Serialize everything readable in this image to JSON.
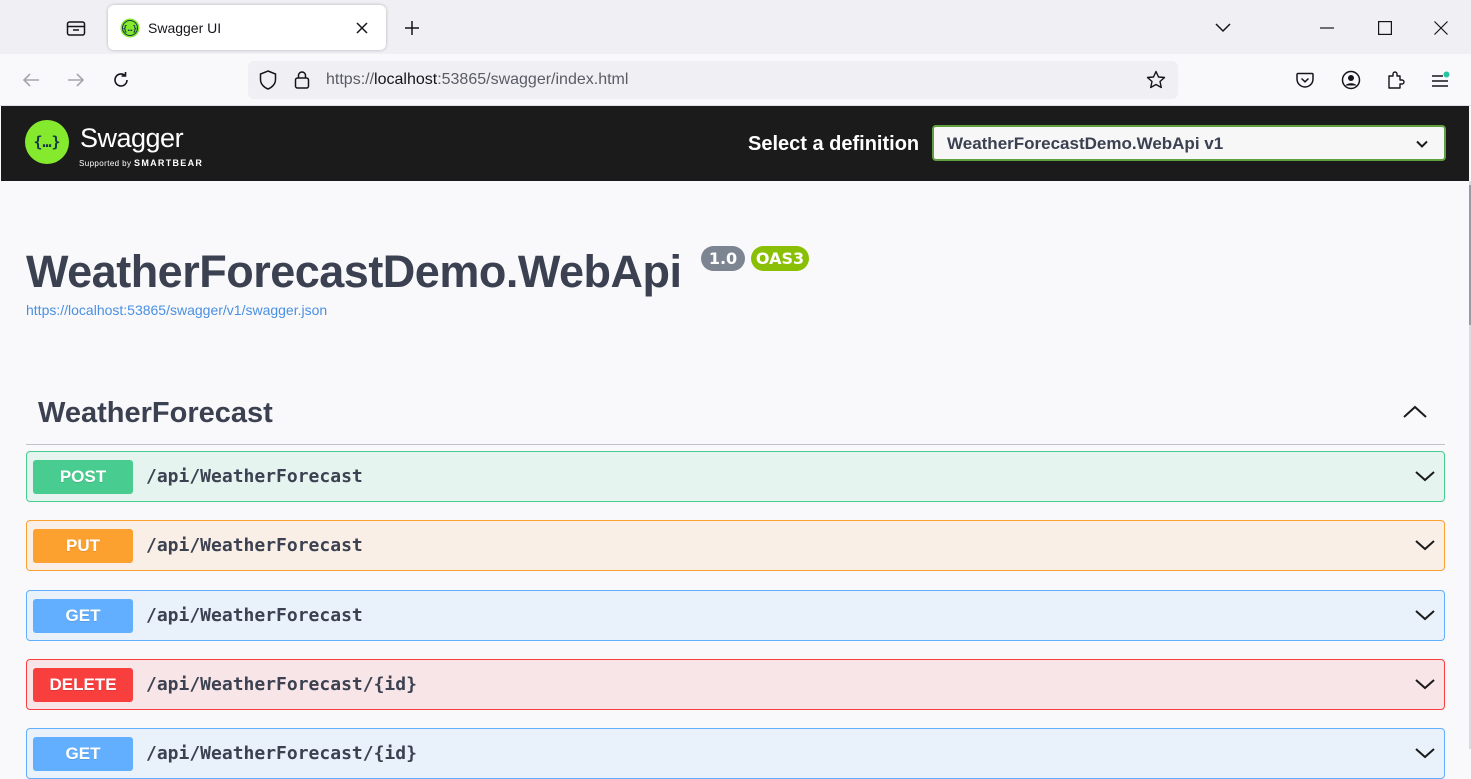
{
  "browser": {
    "tab": {
      "title": "Swagger UI"
    },
    "url": {
      "scheme": "https://",
      "host": "localhost",
      "rest": ":53865/swagger/index.html"
    }
  },
  "topbar": {
    "brand": "Swagger",
    "brand_sub_prefix": "Supported by",
    "brand_sub_company": "SMARTBEAR",
    "select_label": "Select a definition",
    "selected_definition": "WeatherForecastDemo.WebApi v1"
  },
  "info": {
    "title": "WeatherForecastDemo.WebApi",
    "version": "1.0",
    "oas": "OAS3",
    "spec_link": "https://localhost:53865/swagger/v1/swagger.json"
  },
  "tag": {
    "name": "WeatherForecast",
    "operations": [
      {
        "method": "POST",
        "path": "/api/WeatherForecast"
      },
      {
        "method": "PUT",
        "path": "/api/WeatherForecast"
      },
      {
        "method": "GET",
        "path": "/api/WeatherForecast"
      },
      {
        "method": "DELETE",
        "path": "/api/WeatherForecast/{id}"
      },
      {
        "method": "GET",
        "path": "/api/WeatherForecast/{id}"
      }
    ]
  },
  "colors": {
    "post": "#49cc90",
    "put": "#fca130",
    "get": "#61affe",
    "delete": "#f93e3e",
    "swagger_green": "#85ea2d"
  }
}
